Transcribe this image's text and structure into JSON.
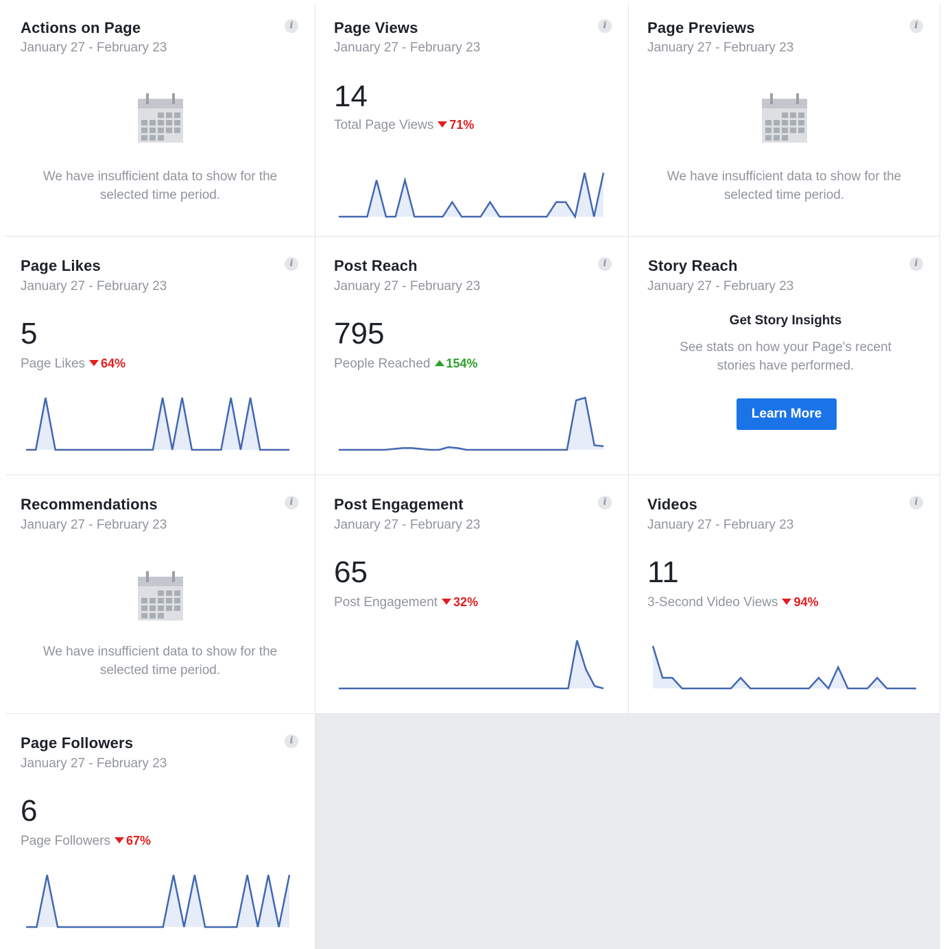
{
  "colors": {
    "accent": "#1a74e8",
    "line": "#4267b2",
    "fill": "#e6ecf8",
    "down": "#e02020",
    "up": "#2ca02c"
  },
  "cards": {
    "actions_on_page": {
      "title": "Actions on Page",
      "date_range": "January 27 - February 23",
      "insufficient_line1": "We have insufficient data to show for the",
      "insufficient_line2": "selected time period.",
      "icon": "calendar-icon"
    },
    "page_views": {
      "title": "Page Views",
      "date_range": "January 27 - February 23",
      "value": "14",
      "label": "Total Page Views",
      "change": "71%",
      "direction": "down"
    },
    "page_previews": {
      "title": "Page Previews",
      "date_range": "January 27 - February 23",
      "insufficient_line1": "We have insufficient data to show for the",
      "insufficient_line2": "selected time period.",
      "icon": "calendar-icon"
    },
    "page_likes": {
      "title": "Page Likes",
      "date_range": "January 27 - February 23",
      "value": "5",
      "label": "Page Likes",
      "change": "64%",
      "direction": "down"
    },
    "post_reach": {
      "title": "Post Reach",
      "date_range": "January 27 - February 23",
      "value": "795",
      "label": "People Reached",
      "change": "154%",
      "direction": "up"
    },
    "story_reach": {
      "title": "Story Reach",
      "date_range": "January 27 - February 23",
      "heading": "Get Story Insights",
      "desc_line1": "See stats on how your Page's recent",
      "desc_line2": "stories have performed.",
      "button": "Learn More"
    },
    "recommendations": {
      "title": "Recommendations",
      "date_range": "January 27 - February 23",
      "insufficient_line1": "We have insufficient data to show for the",
      "insufficient_line2": "selected time period.",
      "icon": "calendar-icon"
    },
    "post_engagement": {
      "title": "Post Engagement",
      "date_range": "January 27 - February 23",
      "value": "65",
      "label": "Post Engagement",
      "change": "32%",
      "direction": "down"
    },
    "videos": {
      "title": "Videos",
      "date_range": "January 27 - February 23",
      "value": "11",
      "label": "3-Second Video Views",
      "change": "94%",
      "direction": "down"
    },
    "page_followers": {
      "title": "Page Followers",
      "date_range": "January 27 - February 23",
      "value": "6",
      "label": "Page Followers",
      "change": "67%",
      "direction": "down"
    }
  },
  "chart_data": [
    {
      "id": "page_views",
      "type": "area",
      "series": [
        {
          "values": [
            0,
            0,
            0,
            0,
            1,
            0,
            0,
            1,
            0,
            0,
            0,
            0,
            0.4,
            0,
            0,
            0,
            0.4,
            0,
            0,
            0,
            0,
            0,
            0,
            0.4,
            0.4,
            0,
            1.2,
            0,
            1.2
          ]
        }
      ]
    },
    {
      "id": "page_likes",
      "type": "area",
      "series": [
        {
          "values": [
            0,
            0,
            1,
            0,
            0,
            0,
            0,
            0,
            0,
            0,
            0,
            0,
            0,
            0,
            1,
            0,
            1,
            0,
            0,
            0,
            0,
            1,
            0,
            1,
            0,
            0,
            0,
            0
          ]
        }
      ]
    },
    {
      "id": "post_reach",
      "type": "area",
      "series": [
        {
          "values": [
            0,
            0,
            0,
            0,
            0,
            0,
            0.01,
            0.02,
            0.02,
            0.01,
            0,
            0,
            0.03,
            0.02,
            0,
            0,
            0,
            0,
            0,
            0,
            0,
            0,
            0,
            0,
            0,
            0,
            0.55,
            0.58,
            0.05,
            0.04
          ]
        }
      ]
    },
    {
      "id": "post_engagement",
      "type": "area",
      "series": [
        {
          "values": [
            0,
            0,
            0,
            0,
            0,
            0,
            0,
            0,
            0,
            0,
            0,
            0,
            0,
            0,
            0,
            0,
            0,
            0,
            0,
            0,
            0,
            0,
            0,
            0,
            0,
            0,
            0,
            1,
            0.4,
            0.05,
            0
          ]
        }
      ]
    },
    {
      "id": "videos",
      "type": "area",
      "series": [
        {
          "values": [
            0.8,
            0.2,
            0.2,
            0,
            0,
            0,
            0,
            0,
            0,
            0.2,
            0,
            0,
            0,
            0,
            0,
            0,
            0,
            0.2,
            0,
            0.4,
            0,
            0,
            0,
            0.2,
            0,
            0,
            0,
            0
          ]
        }
      ]
    },
    {
      "id": "page_followers",
      "type": "area",
      "series": [
        {
          "values": [
            0,
            0,
            1,
            0,
            0,
            0,
            0,
            0,
            0,
            0,
            0,
            0,
            0,
            0,
            1,
            0,
            1,
            0,
            0,
            0,
            0,
            1,
            0,
            1,
            0,
            1
          ]
        }
      ]
    }
  ]
}
